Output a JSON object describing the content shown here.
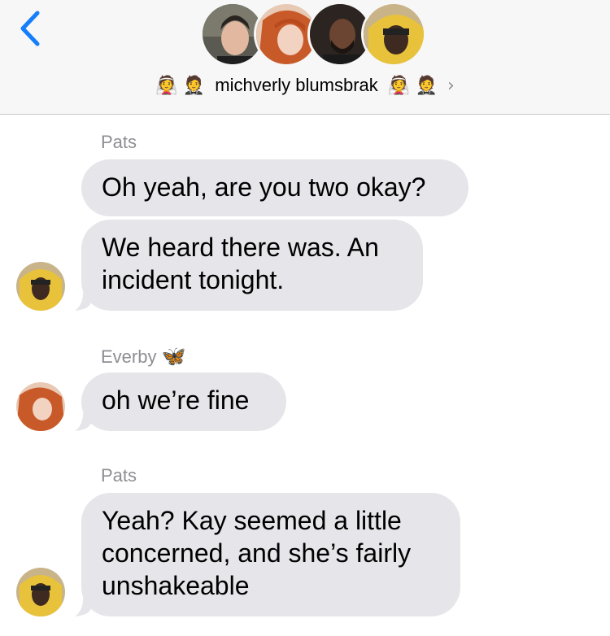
{
  "header": {
    "title": "michverly blumsbrak",
    "emoji_left": [
      "👰",
      "🤵"
    ],
    "emoji_right": [
      "👰",
      "🤵"
    ],
    "chevron": "›",
    "avatars": [
      "dark-hair-man-avatar",
      "red-hair-woman-avatar",
      "bearded-man-avatar",
      "yellow-hood-person-avatar"
    ]
  },
  "messages": [
    {
      "sender": "Pats",
      "text": "Oh yeah, are you two okay?"
    },
    {
      "sender": "",
      "lines": [
        "We heard there was. An",
        "incident tonight."
      ]
    },
    {
      "sender": "Everby",
      "sender_emoji": "🦋",
      "text": "oh we’re fine"
    },
    {
      "sender": "Pats",
      "lines": [
        "Yeah? Kay seemed a little",
        "concerned, and she’s fairly",
        "unshakeable"
      ]
    }
  ],
  "colors": {
    "accent": "#147efb",
    "bubble": "#e5e5ea",
    "sender": "#8e8e93"
  }
}
